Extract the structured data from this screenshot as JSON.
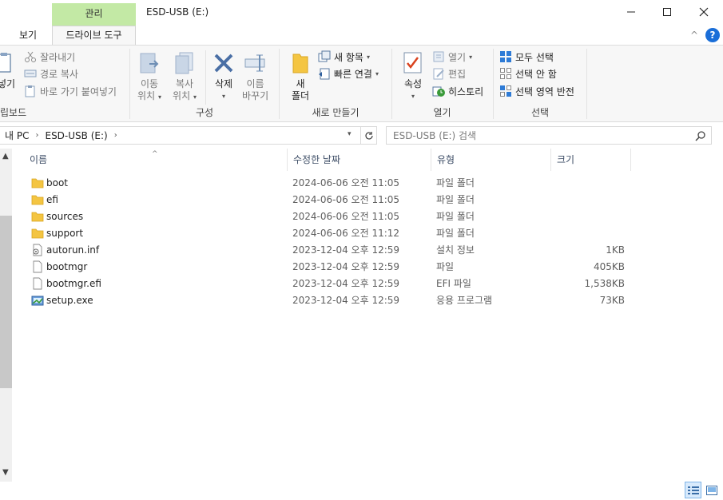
{
  "titlebar": {
    "context_header": "관리",
    "window_title": "ESD-USB (E:)"
  },
  "tabs": {
    "view": "보기",
    "drive_tools": "드라이브 도구"
  },
  "ribbon": {
    "clipboard": {
      "label": "립보드",
      "paste_partial": "넣기",
      "cut": "잘라내기",
      "copy_path": "경로 복사",
      "paste_shortcut": "바로 가기 붙여넣기"
    },
    "organize": {
      "label": "구성",
      "move_to": [
        "이동",
        "위치"
      ],
      "copy_to": [
        "복사",
        "위치"
      ],
      "delete": "삭제",
      "rename": [
        "이름",
        "바꾸기"
      ]
    },
    "new": {
      "label": "새로 만들기",
      "new_folder": [
        "새",
        "폴더"
      ],
      "new_item": "새 항목",
      "easy_access": "빠른 연결"
    },
    "open": {
      "label": "열기",
      "properties": "속성",
      "open": "열기",
      "edit": "편집",
      "history": "히스토리"
    },
    "select": {
      "label": "선택",
      "select_all": "모두 선택",
      "select_none": "선택 안 함",
      "invert": "선택 영역 반전"
    }
  },
  "address": {
    "crumbs": [
      "내 PC",
      "ESD-USB (E:)"
    ],
    "search_placeholder": "ESD-USB (E:) 검색"
  },
  "columns": {
    "name": "이름",
    "date": "수정한 날짜",
    "type": "유형",
    "size": "크기"
  },
  "files": [
    {
      "name": "boot",
      "date": "2024-06-06 오전 11:05",
      "type": "파일 폴더",
      "size": "",
      "icon": "folder-icon"
    },
    {
      "name": "efi",
      "date": "2024-06-06 오전 11:05",
      "type": "파일 폴더",
      "size": "",
      "icon": "folder-icon"
    },
    {
      "name": "sources",
      "date": "2024-06-06 오전 11:05",
      "type": "파일 폴더",
      "size": "",
      "icon": "folder-icon"
    },
    {
      "name": "support",
      "date": "2024-06-06 오전 11:12",
      "type": "파일 폴더",
      "size": "",
      "icon": "folder-icon"
    },
    {
      "name": "autorun.inf",
      "date": "2023-12-04 오후 12:59",
      "type": "설치 정보",
      "size": "1KB",
      "icon": "setup-info-icon"
    },
    {
      "name": "bootmgr",
      "date": "2023-12-04 오후 12:59",
      "type": "파일",
      "size": "405KB",
      "icon": "file-icon"
    },
    {
      "name": "bootmgr.efi",
      "date": "2023-12-04 오후 12:59",
      "type": "EFI 파일",
      "size": "1,538KB",
      "icon": "file-icon"
    },
    {
      "name": "setup.exe",
      "date": "2023-12-04 오후 12:59",
      "type": "응용 프로그램",
      "size": "73KB",
      "icon": "setup-exe-icon"
    }
  ],
  "colors": {
    "context_tab": "#c3e9a5",
    "accent": "#1a6ed8",
    "folder": "#f4c542"
  }
}
